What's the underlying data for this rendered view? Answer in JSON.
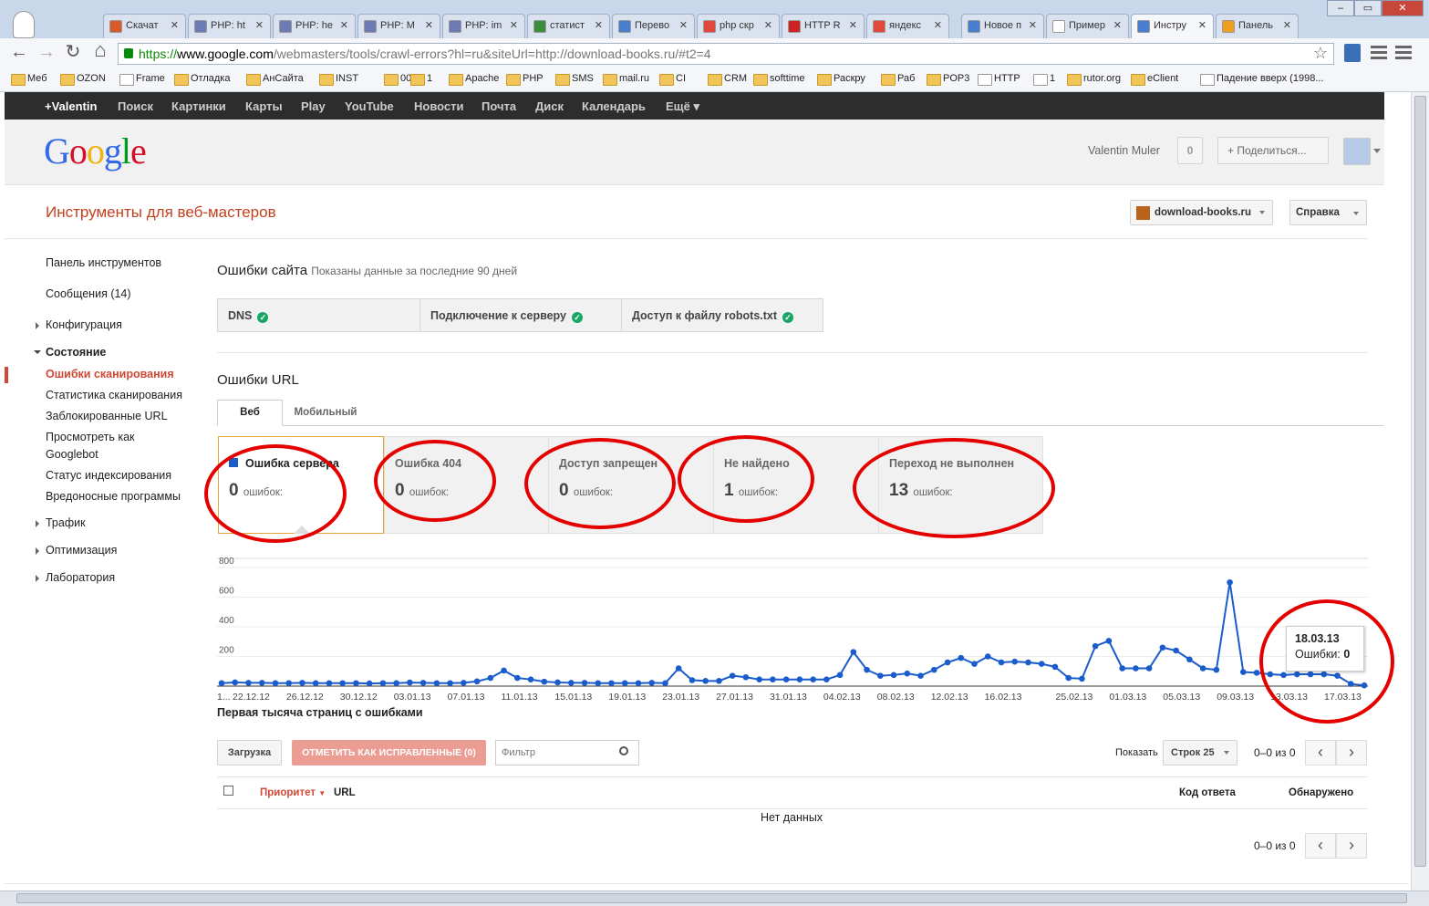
{
  "browser": {
    "tabs": [
      {
        "label": "Скачат",
        "color": "#d65a2a"
      },
      {
        "label": "PHP: ht",
        "color": "#6d7bb5"
      },
      {
        "label": "PHP: he",
        "color": "#6d7bb5"
      },
      {
        "label": "PHP: M",
        "color": "#6d7bb5"
      },
      {
        "label": "PHP: im",
        "color": "#6d7bb5"
      },
      {
        "label": "статист",
        "color": "#3d8b3d"
      },
      {
        "label": "Перево",
        "color": "#4a7fd0"
      },
      {
        "label": "php скр",
        "color": "#e04a3a"
      },
      {
        "label": "HTTP R",
        "color": "#cc2222"
      },
      {
        "label": "яндекс",
        "color": "#e04a3a"
      },
      {
        "label": "Новое п",
        "color": "#4a7fd0"
      },
      {
        "label": "Пример",
        "color": "#ffffff"
      },
      {
        "label": "Инстру",
        "color": "#4a7fd0"
      },
      {
        "label": "Панель",
        "color": "#f0a020"
      }
    ],
    "url": {
      "scheme": "https://",
      "domain": "www.google.com",
      "path": "/webmasters/tools/crawl-errors?hl=ru&siteUrl=http://download-books.ru/#t2=4"
    },
    "bookmarks": [
      "Меб",
      "OZON",
      "Frame",
      "Отладка",
      "АнСайта",
      "INST",
      "00",
      "1",
      "Apache",
      "PHP",
      "SMS",
      "mail.ru",
      "CI",
      "CRM",
      "softtime",
      "Раскру",
      "Раб",
      "POP3",
      "HTTP",
      "1",
      "rutor.org",
      "eClient",
      "Падение вверх (1998..."
    ]
  },
  "gbar": [
    "+Valentin",
    "Поиск",
    "Картинки",
    "Карты",
    "Play",
    "YouTube",
    "Новости",
    "Почта",
    "Диск",
    "Календарь",
    "Ещё ▾"
  ],
  "header": {
    "logo": "Google",
    "user": "Valentin Muler",
    "notifications": "0",
    "share": "+ Поделиться..."
  },
  "wmt": {
    "title": "Инструменты для веб-мастеров",
    "site": "download-books.ru",
    "help": "Справка"
  },
  "sidebar": [
    {
      "label": "Панель инструментов",
      "style": ""
    },
    {
      "label": "Сообщения (14)",
      "style": ""
    },
    {
      "label": "Конфигурация",
      "style": "tri"
    },
    {
      "label": "Состояние",
      "style": "open bold"
    },
    {
      "label": "Ошибки сканирования",
      "style": "active"
    },
    {
      "label": "Статистика сканирования",
      "style": ""
    },
    {
      "label": "Заблокированные URL",
      "style": ""
    },
    {
      "label": "Просмотреть как",
      "style": ""
    },
    {
      "label": "Googlebot",
      "style": ""
    },
    {
      "label": "Статус индексирования",
      "style": ""
    },
    {
      "label": "Вредоносные программы",
      "style": ""
    },
    {
      "label": "Трафик",
      "style": "tri"
    },
    {
      "label": "Оптимизация",
      "style": "tri"
    },
    {
      "label": "Лаборатория",
      "style": "tri"
    }
  ],
  "site_errors": {
    "title": "Ошибки сайта",
    "subtitle": "Показаны данные за последние 90 дней",
    "cells": [
      "DNS",
      "Подключение к серверу",
      "Доступ к файлу robots.txt"
    ]
  },
  "url_errors": {
    "title": "Ошибки URL",
    "tabs": [
      "Веб",
      "Мобильный"
    ],
    "cards": [
      {
        "title": "Ошибка сервера",
        "count": "0",
        "unit": "ошибок:"
      },
      {
        "title": "Ошибка 404",
        "count": "0",
        "unit": "ошибок:"
      },
      {
        "title": "Доступ запрещен",
        "count": "0",
        "unit": "ошибок:"
      },
      {
        "title": "Не найдено",
        "count": "1",
        "unit": "ошибок:"
      },
      {
        "title": "Переход не выполнен",
        "count": "13",
        "unit": "ошибок:"
      }
    ]
  },
  "chart_data": {
    "type": "line",
    "color": "#1a5ccc",
    "y_ticks": [
      "800",
      "600",
      "400",
      "200"
    ],
    "ylim": [
      0,
      800
    ],
    "x_labels": [
      "1...",
      "22.12.12",
      "26.12.12",
      "30.12.12",
      "03.01.13",
      "07.01.13",
      "11.01.13",
      "15.01.13",
      "19.01.13",
      "23.01.13",
      "27.01.13",
      "31.01.13",
      "04.02.13",
      "08.02.13",
      "12.02.13",
      "16.02.13",
      "25.02.13",
      "01.03.13",
      "05.03.13",
      "09.03.13",
      "13.03.13",
      "17.03.13"
    ],
    "values": [
      20,
      25,
      22,
      22,
      20,
      20,
      22,
      20,
      20,
      20,
      20,
      18,
      20,
      20,
      24,
      22,
      20,
      20,
      22,
      32,
      55,
      105,
      55,
      45,
      30,
      25,
      22,
      22,
      20,
      20,
      20,
      20,
      22,
      20,
      120,
      40,
      35,
      35,
      70,
      60,
      45,
      45,
      45,
      45,
      45,
      45,
      75,
      230,
      110,
      70,
      75,
      85,
      70,
      110,
      160,
      190,
      150,
      200,
      160,
      165,
      160,
      150,
      130,
      55,
      50,
      270,
      305,
      120,
      120,
      120,
      260,
      240,
      180,
      120,
      110,
      700,
      95,
      90,
      80,
      75,
      80,
      80,
      80,
      70,
      15,
      5
    ],
    "tooltip": {
      "date": "18.03.13",
      "label": "Ошибки:",
      "value": "0"
    }
  },
  "table": {
    "title": "Первая тысяча страниц с ошибками",
    "download": "Загрузка",
    "mark_fixed": "ОТМЕТИТЬ КАК ИСПРАВЛЕННЫЕ (0)",
    "filter_placeholder": "Фильтр",
    "show": "Показать",
    "rows_select": "Строк 25",
    "range": "0–0 из 0",
    "cols": [
      "Приоритет",
      "URL",
      "Код ответа",
      "Обнаружено"
    ],
    "empty": "Нет данных"
  }
}
